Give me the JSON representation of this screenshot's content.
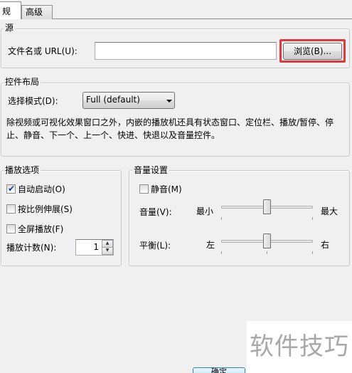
{
  "tabs": [
    {
      "label": "规"
    },
    {
      "label": "高级"
    }
  ],
  "source": {
    "title": "源",
    "file_label": "文件名或 URL(U):",
    "file_value": "",
    "browse_label": "浏览(B)..."
  },
  "layout": {
    "title": "控件布局",
    "mode_label": "选择模式(D):",
    "mode_value": "Full (default)",
    "description_line1": "除视频或可视化效果窗口之外，内嵌的播放机还具有状态窗口、定位栏、播放/暂停、停",
    "description_line2": "止、静音、下一个、上一个、快进、快退以及音量控件。"
  },
  "playback": {
    "title": "播放选项",
    "autostart_label": "自动启动(O)",
    "autostart_checked": true,
    "stretch_label": "按比例伸展(S)",
    "stretch_checked": false,
    "fullscreen_label": "全屏播放(F)",
    "fullscreen_checked": false,
    "count_label": "播放计数(N):",
    "count_value": "1"
  },
  "volume": {
    "title": "音量设置",
    "mute_label": "静音(M)",
    "mute_checked": false,
    "volume_label": "音量(V):",
    "volume_min": "最小",
    "volume_max": "最大",
    "volume_level": 0.5,
    "balance_label": "平衡(L):",
    "balance_left": "左",
    "balance_right": "右",
    "balance_level": 0.5
  },
  "bottom": {
    "partial_button_label": "确定"
  },
  "watermark": "软件技巧",
  "colors": {
    "highlight": "#e0383f",
    "check": "#1c3f8f"
  }
}
